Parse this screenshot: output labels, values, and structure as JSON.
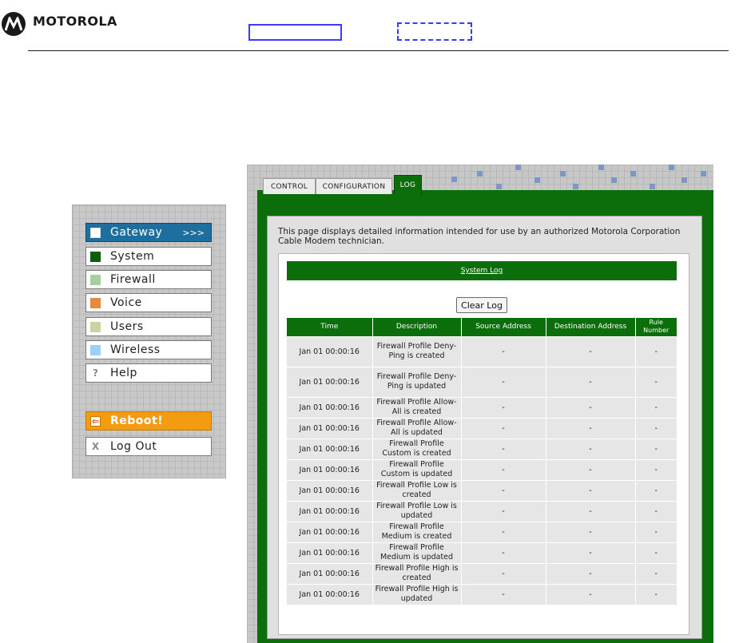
{
  "header": {
    "brand": "MOTOROLA"
  },
  "nav": {
    "items": [
      {
        "label": "Gateway",
        "extra": ">>>",
        "color": "#ffffff"
      },
      {
        "label": "System",
        "color": "#0b5e0b"
      },
      {
        "label": "Firewall",
        "color": "#9fd39a"
      },
      {
        "label": "Voice",
        "color": "#e58a3c"
      },
      {
        "label": "Users",
        "color": "#cfd2a0"
      },
      {
        "label": "Wireless",
        "color": "#9ed0f7"
      },
      {
        "label": "Help",
        "glyph": "?"
      }
    ],
    "reboot": {
      "label": "Reboot!",
      "glyph": "⇐"
    },
    "logout": {
      "label": "Log Out",
      "glyph": "X"
    }
  },
  "tabs": [
    "CONTROL",
    "CONFIGURATION",
    "LOG"
  ],
  "intro": "This page displays detailed information intended for use by an authorized Motorola Corporation Cable Modem technician.",
  "log": {
    "title": "System Log",
    "clear_button": "Clear Log",
    "columns": [
      "Time",
      "Description",
      "Source Address",
      "Destination Address",
      "Rule Number"
    ],
    "rows": [
      {
        "time": "Jan 01 00:00:16",
        "desc": "Firewall Profile Deny-Ping is created",
        "src": "-",
        "dst": "-",
        "rule": "-"
      },
      {
        "time": "Jan 01 00:00:16",
        "desc": "Firewall Profile Deny-Ping is updated",
        "src": "-",
        "dst": "-",
        "rule": "-"
      },
      {
        "time": "Jan 01 00:00:16",
        "desc": "Firewall Profile Allow-All is created",
        "src": "-",
        "dst": "-",
        "rule": "-"
      },
      {
        "time": "Jan 01 00:00:16",
        "desc": "Firewall Profile Allow-All is updated",
        "src": "-",
        "dst": "-",
        "rule": "-"
      },
      {
        "time": "Jan 01 00:00:16",
        "desc": "Firewall Profile Custom is created",
        "src": "-",
        "dst": "-",
        "rule": "-"
      },
      {
        "time": "Jan 01 00:00:16",
        "desc": "Firewall Profile Custom is updated",
        "src": "-",
        "dst": "-",
        "rule": "-"
      },
      {
        "time": "Jan 01 00:00:16",
        "desc": "Firewall Profile Low is created",
        "src": "-",
        "dst": "-",
        "rule": "-"
      },
      {
        "time": "Jan 01 00:00:16",
        "desc": "Firewall Profile Low is updated",
        "src": "-",
        "dst": "-",
        "rule": "-"
      },
      {
        "time": "Jan 01 00:00:16",
        "desc": "Firewall Profile Medium is created",
        "src": "-",
        "dst": "-",
        "rule": "-"
      },
      {
        "time": "Jan 01 00:00:16",
        "desc": "Firewall Profile Medium is updated",
        "src": "-",
        "dst": "-",
        "rule": "-"
      },
      {
        "time": "Jan 01 00:00:16",
        "desc": "Firewall Profile High is created",
        "src": "-",
        "dst": "-",
        "rule": "-"
      },
      {
        "time": "Jan 01 00:00:16",
        "desc": "Firewall Profile High is updated",
        "src": "-",
        "dst": "-",
        "rule": "-"
      }
    ]
  }
}
